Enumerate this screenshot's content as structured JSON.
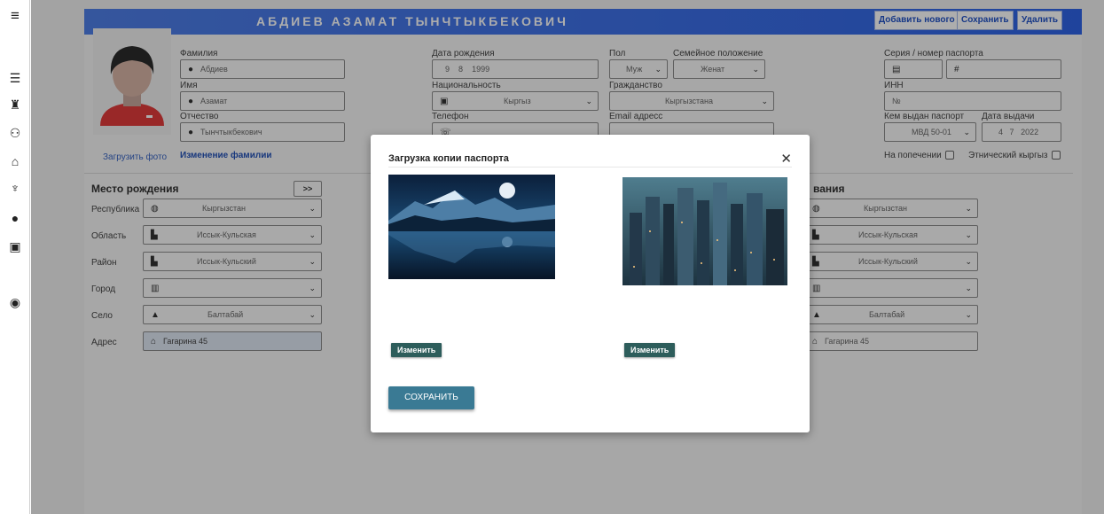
{
  "header": {
    "title": "АБДИЕВ АЗАМАТ ТЫНЧТЫКБЕКОВИЧ",
    "add_new": "Добавить нового",
    "save": "Сохранить",
    "delete": "Удалить"
  },
  "left_rail_icons": [
    "menu-icon",
    "list-icon",
    "graduation-icon",
    "family-icon",
    "bank-icon",
    "award-icon",
    "info-icon",
    "id-card-icon",
    "location-icon"
  ],
  "person": {
    "surname_label": "Фамилия",
    "surname": "Абдиев",
    "name_label": "Имя",
    "name": "Азамат",
    "patronymic_label": "Отчество",
    "patronymic": "Тынчтыкбекович",
    "upload_photo": "Загрузить фото",
    "change_surname": "Изменение фамилии"
  },
  "birth": {
    "label": "Дата рождения",
    "day": "9",
    "month": "8",
    "year": "1999",
    "nationality_label": "Национальность",
    "nationality": "Кыргыз",
    "phone_label": "Телефон"
  },
  "gender": {
    "label": "Пол",
    "value": "Муж",
    "marital_label": "Семейное положение",
    "marital": "Женат",
    "citizenship_label": "Гражданство",
    "citizenship": "Кыргызстана",
    "email_label": "Email адресс"
  },
  "passport": {
    "label": "Серия / номер паспорта",
    "inn_label": "ИНН",
    "inn_placeholder": "№",
    "issued_by_label": "Кем выдан паспорт",
    "issued_by": "МВД 50-01",
    "issue_date_label": "Дата выдачи",
    "issue_day": "4",
    "issue_month": "7",
    "issue_year": "2022",
    "guardianship": "На попечении",
    "ethnic": "Этнический кыргыз"
  },
  "birthplace": {
    "title": "Место рождения",
    "copy_button": ">>",
    "republic_label": "Республика",
    "republic": "Кыргызстан",
    "region_label": "Область",
    "region": "Иссык-Кульская",
    "district_label": "Район",
    "district": "Иссык-Кульский",
    "city_label": "Город",
    "city": "",
    "village_label": "Село",
    "village": "Балтабай",
    "address_label": "Адрес",
    "address": "Гагарина 45"
  },
  "residence": {
    "title_partial": "вания",
    "republic": "Кыргызстан",
    "region": "Иссык-Кульская",
    "district": "Иссык-Кульский",
    "city": "",
    "village": "Балтабай",
    "address": "Гагарина 45"
  },
  "modal": {
    "title": "Загрузка копии паспорта",
    "change1": "Изменить",
    "change2": "Изменить",
    "save": "СОХРАНИТЬ"
  }
}
